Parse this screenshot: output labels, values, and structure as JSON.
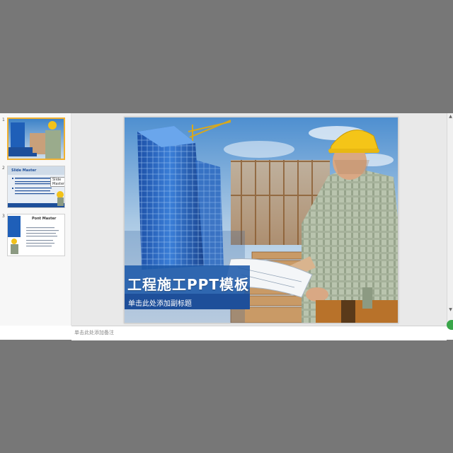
{
  "thumbnails": [
    {
      "number": "1",
      "selected": true
    },
    {
      "number": "2",
      "selected": false,
      "title": "Slide Master",
      "tooltip": "Slide Master"
    },
    {
      "number": "3",
      "selected": false,
      "title": "Pont Master"
    }
  ],
  "slide": {
    "title": "工程施工PPT模板",
    "subtitle": "单击此处添加副标题"
  },
  "notes": {
    "placeholder": "单击此处添加备注"
  },
  "colors": {
    "accent_blue": "#1e4f9a",
    "selection": "#f0b030",
    "zoom_button": "#3aa64a"
  }
}
